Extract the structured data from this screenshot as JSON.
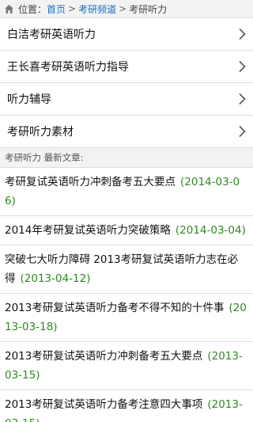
{
  "breadcrumb": {
    "prefix": "位置：",
    "items": [
      "首页",
      "考研频道"
    ],
    "current": "考研听力",
    "sep": ">"
  },
  "categories": [
    "白洁考研英语听力",
    "王长喜考研英语听力指导",
    "听力辅导",
    "考研听力素材"
  ],
  "latest": {
    "header": "考研听力 最新文章:",
    "articles": [
      {
        "title": "考研复试英语听力冲刺备考五大要点",
        "date": "(2014-03-06)"
      },
      {
        "title": "2014年考研复试英语听力突破策略",
        "date": "(2014-03-04)"
      },
      {
        "title": "突破七大听力障碍 2013考研复试英语听力志在必得",
        "date": "(2013-04-12)"
      },
      {
        "title": "2013考研复试英语听力备考不得不知的十件事",
        "date": "(2013-03-18)"
      },
      {
        "title": "2013考研复试英语听力冲刺备考五大要点",
        "date": "(2013-03-15)"
      },
      {
        "title": "2013考研复试英语听力备考注意四大事项",
        "date": "(2013-03-15)"
      }
    ]
  },
  "colors": {
    "link": "#1a6fc0",
    "date": "#2e8a1f"
  },
  "icons": {
    "breadcrumb": "home-icon",
    "row": "chevron-right-icon"
  }
}
